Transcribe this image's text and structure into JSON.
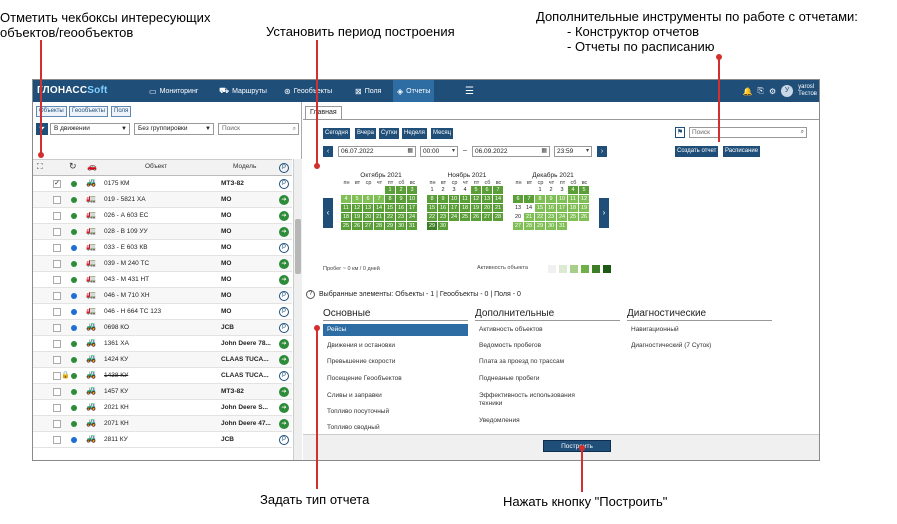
{
  "annotations": {
    "checkbox_hint_1": "Отметить чекбоксы интересующих",
    "checkbox_hint_2": "объектов/геообъектов",
    "period_hint": "Установить период построения",
    "tools_hint_1": "Дополнительные инструменты по работе с отчетами:",
    "tools_hint_2": "- Конструктор отчетов",
    "tools_hint_3": "- Отчеты по расписанию",
    "report_type_hint": "Задать тип отчета",
    "build_hint": "Нажать кнопку \"Построить\""
  },
  "topbar": {
    "logo_prefix": "ГЛОНАСС",
    "logo_suffix": "Soft",
    "nav": [
      {
        "label": "Мониторинг",
        "icon": "monitor-icon"
      },
      {
        "label": "Маршруты",
        "icon": "route-icon"
      },
      {
        "label": "Геообъекты",
        "icon": "geo-icon"
      },
      {
        "label": "Поля",
        "icon": "field-icon"
      },
      {
        "label": "Отчеты",
        "icon": "report-icon"
      }
    ],
    "menu_glyph": "☰",
    "bell_glyph": "🔔",
    "user_name": "yarosl",
    "user_sub": "Тестов",
    "avatar_letter": "У"
  },
  "left": {
    "tabs": [
      "Объекты",
      "Геообъекты",
      "Поля"
    ],
    "filter_state": "В движении",
    "grouping": "Без группировки",
    "search_placeholder": "Поиск",
    "col_object": "Объект",
    "col_model": "Модель",
    "rows": [
      {
        "name": "0175 КМ",
        "model": "МТЗ-82",
        "dot": "#2e8b3a",
        "status": "p",
        "checked": "✓",
        "veh": "🚜",
        "strike": false
      },
      {
        "name": "019 - 5821 ХА",
        "model": "МО",
        "dot": "#2e8b3a",
        "status": "g",
        "checked": "",
        "veh": "🚛",
        "strike": false
      },
      {
        "name": "026 - А 603 ЕС",
        "model": "МО",
        "dot": "#2e8b3a",
        "status": "g",
        "checked": "",
        "veh": "🚛",
        "strike": false
      },
      {
        "name": "028 - В 109 УУ",
        "model": "МО",
        "dot": "#2e8b3a",
        "status": "g",
        "checked": "",
        "veh": "🚛",
        "strike": false
      },
      {
        "name": "033 - Е 603 КВ",
        "model": "МО",
        "dot": "#1f6fd1",
        "status": "p",
        "checked": "",
        "veh": "🚛",
        "strike": false
      },
      {
        "name": "039 - М 240 ТС",
        "model": "МО",
        "dot": "#2e8b3a",
        "status": "g",
        "checked": "",
        "veh": "🚛",
        "strike": false
      },
      {
        "name": "043 - М 431 НТ",
        "model": "МО",
        "dot": "#2e8b3a",
        "status": "g",
        "checked": "",
        "veh": "🚛",
        "strike": false
      },
      {
        "name": "046 - М 710 ХН",
        "model": "МО",
        "dot": "#1f6fd1",
        "status": "p",
        "checked": "",
        "veh": "🚛",
        "strike": false
      },
      {
        "name": "046 - Н 664 ТС 123",
        "model": "МО",
        "dot": "#1f6fd1",
        "status": "p",
        "checked": "",
        "veh": "🚛",
        "strike": false
      },
      {
        "name": "0698 КО",
        "model": "JCB",
        "dot": "#1f6fd1",
        "status": "p",
        "checked": "",
        "veh": "🚜",
        "strike": false
      },
      {
        "name": "1361 ХА",
        "model": "John Deere 78...",
        "dot": "#2e8b3a",
        "status": "g",
        "checked": "",
        "veh": "🚜",
        "strike": false
      },
      {
        "name": "1424 КУ",
        "model": "CLAAS TUCA...",
        "dot": "#2e8b3a",
        "status": "g",
        "checked": "",
        "veh": "🚜",
        "strike": false
      },
      {
        "name": "1438 КУ",
        "model": "CLAAS TUCA...",
        "dot": "#2e8b3a",
        "status": "p",
        "checked": "",
        "veh": "🚜",
        "strike": true
      },
      {
        "name": "1457 КУ",
        "model": "МТЗ-82",
        "dot": "#2e8b3a",
        "status": "g",
        "checked": "",
        "veh": "🚜",
        "strike": false
      },
      {
        "name": "2021 КН",
        "model": "John Deere S...",
        "dot": "#2e8b3a",
        "status": "g",
        "checked": "",
        "veh": "🚜",
        "strike": false
      },
      {
        "name": "2071 КН",
        "model": "John Deere 47...",
        "dot": "#2e8b3a",
        "status": "g",
        "checked": "",
        "veh": "🚜",
        "strike": false
      },
      {
        "name": "2811 КУ",
        "model": "JCB",
        "dot": "#1f6fd1",
        "status": "p",
        "checked": "",
        "veh": "🚜",
        "strike": false
      }
    ]
  },
  "right": {
    "tab_main": "Главная",
    "period_buttons": [
      "Сегодня",
      "Вчера",
      "Сутки",
      "Неделя",
      "Месяц"
    ],
    "date_from": "06.07.2022",
    "time_from": "00:00",
    "date_to": "06.09.2022",
    "time_to": "23:59",
    "dash": "–",
    "search_placeholder": "Поиск",
    "create_report_btn": "Создать отчет",
    "schedule_btn": "Расписание",
    "calendars": [
      {
        "title": "Октябрь 2021",
        "offset": 4,
        "days": 31,
        "levels": [
          2,
          2,
          2,
          1,
          1,
          1,
          1,
          2,
          2,
          2,
          2,
          2,
          2,
          2,
          2,
          2,
          2,
          2,
          2,
          2,
          2,
          2,
          2,
          2,
          2,
          2,
          2,
          2,
          2,
          2,
          2
        ]
      },
      {
        "title": "Ноябрь 2021",
        "offset": 0,
        "days": 30,
        "levels": [
          0,
          0,
          0,
          0,
          2,
          2,
          2,
          2,
          2,
          2,
          2,
          2,
          2,
          2,
          2,
          2,
          2,
          2,
          2,
          2,
          2,
          2,
          2,
          2,
          2,
          2,
          2,
          2,
          3,
          2
        ]
      },
      {
        "title": "Декабрь 2021",
        "offset": 2,
        "days": 31,
        "levels": [
          0,
          0,
          0,
          2,
          2,
          2,
          2,
          1,
          1,
          1,
          1,
          1,
          0,
          0,
          1,
          1,
          1,
          1,
          1,
          0,
          1,
          1,
          1,
          1,
          1,
          1,
          1,
          1,
          1,
          1,
          1
        ]
      }
    ],
    "weekdays": [
      "пн",
      "вт",
      "ср",
      "чт",
      "пт",
      "сб",
      "вс"
    ],
    "mileage_text": "Пробег ~ 0 км / 0 дней",
    "activity_label": "Активность объекта",
    "selected_text": "Выбранные элементы:  Объекты - 1   |   Геообъекты - 0   |   Поля - 0",
    "help_glyph": "?",
    "col_main": "Основные",
    "col_extra": "Дополнительные",
    "col_diag": "Диагностические",
    "main_items": [
      "Рейсы",
      "Движения и остановки",
      "Превышение скорости",
      "Посещение Геообъектов",
      "Сливы и заправки",
      "Топливо посуточный",
      "Топливо сводный"
    ],
    "extra_items": [
      "Активность объектов",
      "Ведомость пробегов",
      "Плата за проезд по трассам",
      "Поднеаные пробеги",
      "Эффективность использования",
      "техники",
      "Уведомления"
    ],
    "diag_items": [
      "Навигационный",
      "Диагностический (7 Суток)"
    ],
    "build_btn": "Построить"
  },
  "colors": {
    "accent": "#1f4e79",
    "green": "#2e8b3a",
    "annotation_line": "#d32f2f"
  }
}
